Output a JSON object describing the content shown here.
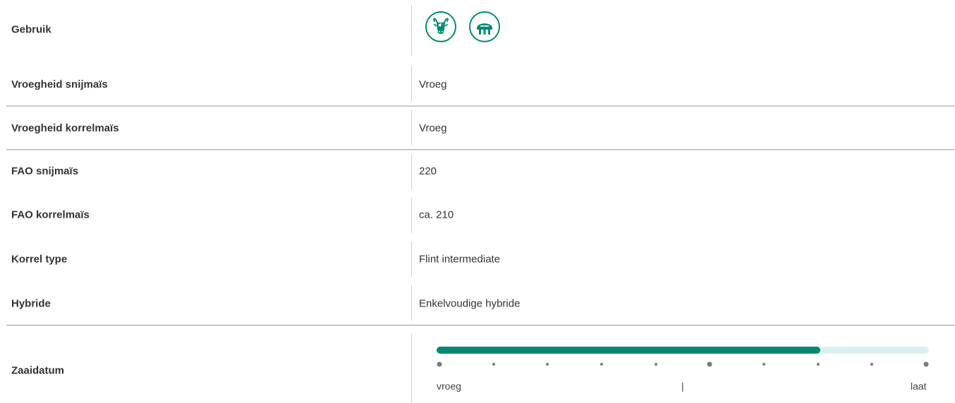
{
  "rows": [
    {
      "label": "Gebruik",
      "value": ""
    },
    {
      "label": "Vroegheid snijmaïs",
      "value": "Vroeg"
    },
    {
      "label": "Vroegheid korrelmaïs",
      "value": "Vroeg"
    },
    {
      "label": "FAO snijmaïs",
      "value": "220"
    },
    {
      "label": "FAO korrelmaïs",
      "value": "ca. 210"
    },
    {
      "label": "Korrel type",
      "value": "Flint intermediate"
    },
    {
      "label": "Hybride",
      "value": "Enkelvoudige hybride"
    },
    {
      "label": "Zaaidatum",
      "value": ""
    }
  ],
  "usage_icons": [
    "cow-icon",
    "silo-icon"
  ],
  "zaaidatum": {
    "progress": 0.78,
    "scale_left": "vroeg",
    "scale_mid": "|",
    "scale_right": "laat",
    "tick_count": 10
  },
  "colors": {
    "accent": "#008a76",
    "accent_light": "#d9f1ee",
    "divider": "#9a9a9a"
  }
}
